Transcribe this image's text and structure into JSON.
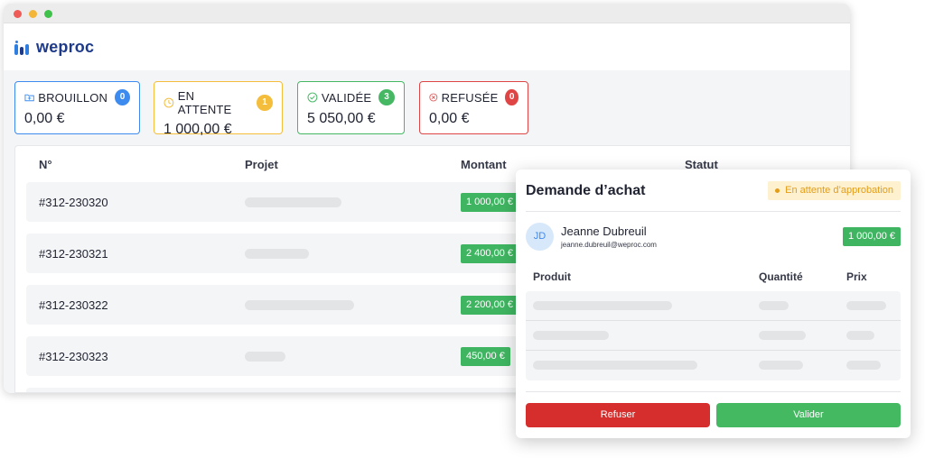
{
  "app": {
    "logo_text": "weproc"
  },
  "status_cards": [
    {
      "label": "BROUILLON",
      "count": "0",
      "amount": "0,00 €",
      "color": "#3d8bef",
      "icon": "folder-icon"
    },
    {
      "label": "EN ATTENTE",
      "count": "1",
      "amount": "1 000,00 €",
      "color": "#f4bd3c",
      "icon": "clock-icon"
    },
    {
      "label": "VALIDÉE",
      "count": "3",
      "amount": "5 050,00 €",
      "color": "#46b864",
      "icon": "check-circle-icon"
    },
    {
      "label": "REFUSÉE",
      "count": "0",
      "amount": "0,00 €",
      "color": "#e04545",
      "icon": "x-circle-icon"
    }
  ],
  "table": {
    "columns": [
      "N°",
      "Projet",
      "Montant",
      "Statut"
    ],
    "rows": [
      {
        "number": "#312-230320",
        "amount": "1 000,00 €"
      },
      {
        "number": "#312-230321",
        "amount": "2 400,00 €"
      },
      {
        "number": "#312-230322",
        "amount": "2 200,00 €"
      },
      {
        "number": "#312-230323",
        "amount": "450,00 €"
      }
    ]
  },
  "modal": {
    "title": "Demande d’achat",
    "status": "En attente d’approbation",
    "user": {
      "initials": "JD",
      "name": "Jeanne Dubreuil",
      "email": "jeanne.dubreuil@weproc.com"
    },
    "amount": "1 000,00 €",
    "columns": [
      "Produit",
      "Quantité",
      "Prix"
    ],
    "refuse_label": "Refuser",
    "validate_label": "Valider"
  }
}
